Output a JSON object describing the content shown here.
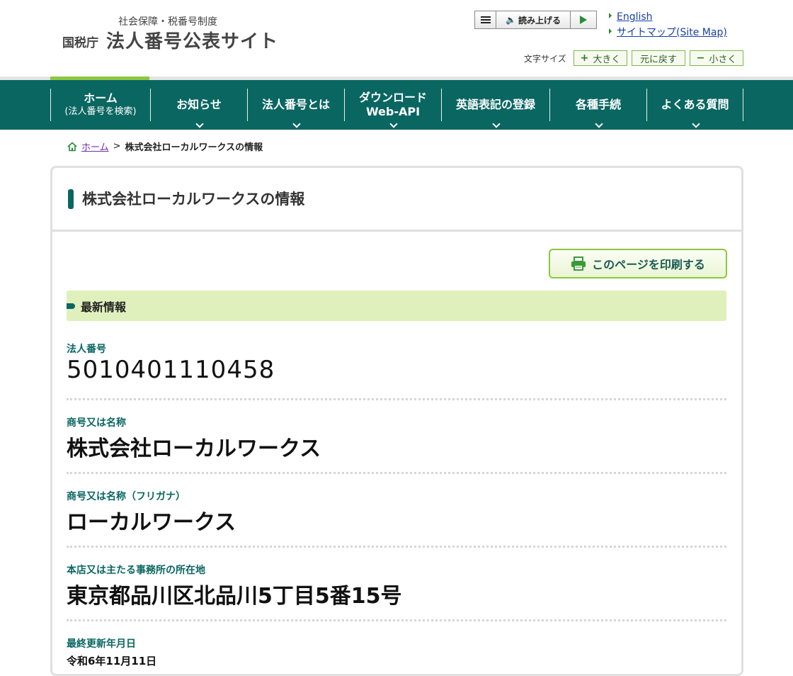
{
  "header": {
    "logo_sub": "社会保障・税番号制度",
    "logo_org": "国税庁",
    "logo_main": "法人番号公表サイト",
    "reader_label": "読み上げる",
    "links": [
      "English",
      "サイトマップ(Site Map)"
    ],
    "fontsize_label": "文字サイズ",
    "fontsize_buttons": {
      "larger": "大きく",
      "reset": "元に戻す",
      "smaller": "小さく"
    }
  },
  "nav": {
    "items": [
      {
        "line1": "ホーム",
        "line2": "(法人番号を検索)"
      },
      {
        "line1": "お知らせ"
      },
      {
        "line1": "法人番号とは"
      },
      {
        "line1": "ダウンロード",
        "line2": "Web-API"
      },
      {
        "line1": "英語表記の登録"
      },
      {
        "line1": "各種手続"
      },
      {
        "line1": "よくある質問"
      }
    ]
  },
  "breadcrumb": {
    "home": "ホーム",
    "separator": ">",
    "current": "株式会社ローカルワークスの情報"
  },
  "page": {
    "title": "株式会社ローカルワークスの情報",
    "print_label": "このページを印刷する",
    "section_title": "最新情報",
    "fields": [
      {
        "label": "法人番号",
        "value": "5010401110458"
      },
      {
        "label": "商号又は名称",
        "value": "株式会社ローカルワークス"
      },
      {
        "label": "商号又は名称（フリガナ）",
        "value": "ローカルワークス"
      },
      {
        "label": "本店又は主たる事務所の所在地",
        "value": "東京都品川区北品川5丁目5番15号"
      },
      {
        "label": "最終更新年月日",
        "value": "令和6年11月11日"
      }
    ]
  },
  "colors": {
    "brand_teal": "#0a6661",
    "accent_green": "#8dc63f",
    "section_bg": "#e0f0bc"
  }
}
